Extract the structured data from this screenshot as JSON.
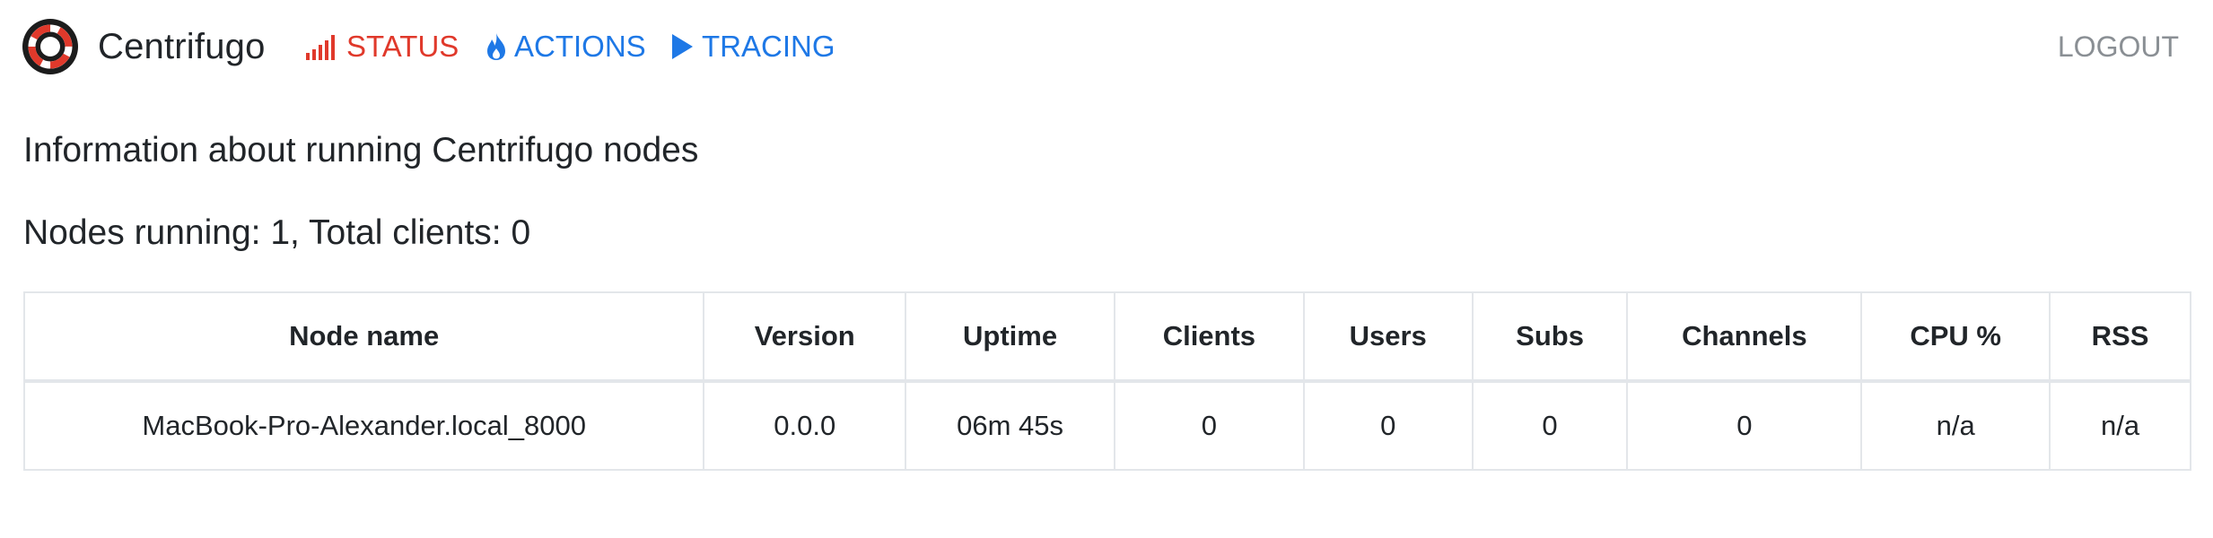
{
  "navbar": {
    "brand": {
      "name": "Centrifugo",
      "icon": "centrifugo-logo-icon"
    },
    "links": [
      {
        "label": "STATUS",
        "icon": "signal-bars-icon",
        "color": "#e0392b"
      },
      {
        "label": "ACTIONS",
        "icon": "flame-icon",
        "color": "#1e78e6"
      },
      {
        "label": "TRACING",
        "icon": "play-icon",
        "color": "#1e78e6"
      }
    ],
    "logout_label": "LOGOUT"
  },
  "main": {
    "headline": "Information about running Centrifugo nodes",
    "summary": {
      "nodes_label": "Nodes running: ",
      "nodes_running": "1",
      "clients_label": ", Total clients: ",
      "total_clients": "0"
    }
  },
  "table": {
    "columns": [
      "Node name",
      "Version",
      "Uptime",
      "Clients",
      "Users",
      "Subs",
      "Channels",
      "CPU %",
      "RSS"
    ],
    "rows": [
      [
        "MacBook-Pro-Alexander.local_8000",
        "0.0.0",
        "06m 45s",
        "0",
        "0",
        "0",
        "0",
        "n/a",
        "n/a"
      ]
    ]
  }
}
